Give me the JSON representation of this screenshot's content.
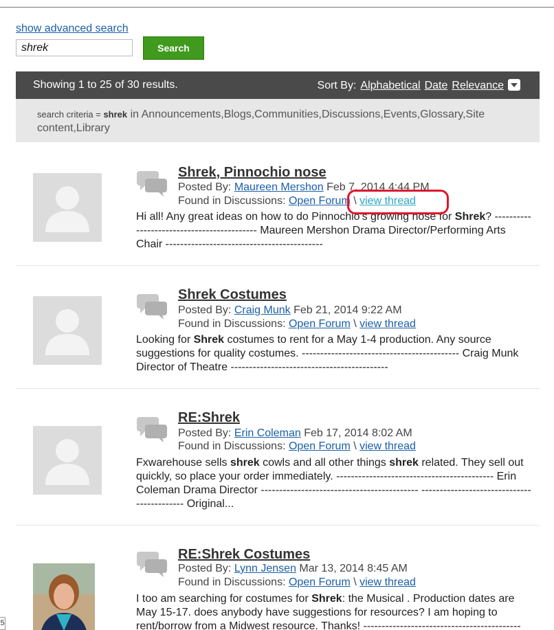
{
  "search": {
    "advanced_link": "show advanced search",
    "query": "shrek",
    "button": "Search"
  },
  "results_bar": {
    "summary": "Showing 1 to 25 of 30 results.",
    "sort_label": "Sort By:",
    "sort_options": [
      "Alphabetical",
      "Date",
      "Relevance"
    ]
  },
  "criteria": {
    "prefix": "search criteria = ",
    "term": "shrek",
    "text": " in Announcements,Blogs,Communities,Discussions,Events,Glossary,Site content,Library"
  },
  "results": [
    {
      "title": "Shrek, Pinnochio nose",
      "posted_by_label": "Posted By: ",
      "author": "Maureen Mershon",
      "date": " Feb 7, 2014 4:44 PM",
      "found_in_label": "Found in Discussions: ",
      "forum": "Open Forum",
      "view": "view thread",
      "snippet": [
        "Hi all! Any great ideas on how to do Pinnochio's growing nose for ",
        "Shrek",
        "? ------------------------------------------- Maureen Mershon Drama Director/Performing Arts Chair -------------------------------------------"
      ]
    },
    {
      "title": "Shrek Costumes",
      "posted_by_label": "Posted By: ",
      "author": "Craig Munk",
      "date": " Feb 21, 2014 9:22 AM",
      "found_in_label": "Found in Discussions: ",
      "forum": "Open Forum",
      "view": "view thread",
      "snippet": [
        "Looking for ",
        "Shrek",
        " costumes to rent for a May 1-4 production. Any source suggestions for quality costumes. ------------------------------------------- Craig Munk Director of Theatre -------------------------------------------"
      ]
    },
    {
      "title": "RE:Shrek",
      "posted_by_label": "Posted By: ",
      "author": "Erin Coleman",
      "date": " Feb 17, 2014 8:02 AM",
      "found_in_label": "Found in Discussions: ",
      "forum": "Open Forum",
      "view": "view thread",
      "snippet": [
        "Fxwarehouse sells ",
        "shrek",
        " cowls and all other things ",
        "shrek",
        " related. They sell out quickly, so place your order immediately. ------------------------------------------- Erin Coleman Drama Director ------------------------------------------- ------------------------------------------- Original..."
      ]
    },
    {
      "title": "RE:Shrek Costumes",
      "posted_by_label": "Posted By: ",
      "author": "Lynn Jensen",
      "date": " Mar 13, 2014 8:45 AM",
      "found_in_label": "Found in Discussions: ",
      "forum": "Open Forum",
      "view": "view thread",
      "snippet": [
        "I too am searching for costumes for ",
        "Shrek",
        ": the Musical . Production dates are May 15-17. does anybody have suggestions for resources? I am hoping to rent/borrow from a Midwest resource. Thanks! -------------------------------------------"
      ]
    }
  ],
  "edge_mark": "5",
  "colors": {
    "link": "#1a5fa8",
    "visited_link": "#2aa6c8",
    "search_button": "#3f9a1d",
    "results_bar": "#4a4a4a",
    "highlight_ring": "#e0162b"
  }
}
